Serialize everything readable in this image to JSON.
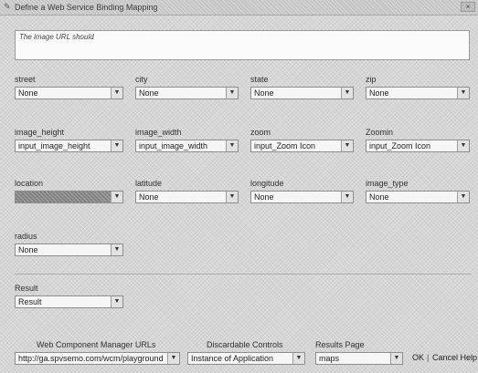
{
  "window": {
    "title": "Define a Web Service Binding Mapping",
    "close_glyph": "×",
    "title_icon": "pencil-icon"
  },
  "description": {
    "text": "The image URL should"
  },
  "fields": {
    "street": {
      "label": "street",
      "value": "None"
    },
    "city": {
      "label": "city",
      "value": "None"
    },
    "state": {
      "label": "state",
      "value": "None"
    },
    "zip": {
      "label": "zip",
      "value": "None"
    },
    "image_height": {
      "label": "image_height",
      "value": "input_image_height"
    },
    "image_width": {
      "label": "image_width",
      "value": "input_image_width"
    },
    "zoom": {
      "label": "zoom",
      "value": "input_Zoom Icon"
    },
    "zoom_icon": {
      "label": "Zoomin",
      "value": "input_Zoom Icon"
    },
    "location": {
      "label": "location",
      "value": ""
    },
    "latitude": {
      "label": "latitude",
      "value": "None"
    },
    "longitude": {
      "label": "longitude",
      "value": "None"
    },
    "image_type": {
      "label": "image_type",
      "value": "None"
    },
    "radius": {
      "label": "radius",
      "value": "None"
    },
    "result": {
      "label": "Result",
      "value": "Result"
    }
  },
  "footer": {
    "wcm_url": {
      "label": "Web Component Manager URLs",
      "value": "http://ga.spvsemo.com/wcm/playground"
    },
    "discardable_controls": {
      "label": "Discardable Controls",
      "value": "Instance of Application"
    },
    "results_page": {
      "label": "Results Page",
      "value": "maps"
    },
    "ok_label": "OK",
    "separator": "|",
    "cancel_label": "Cancel Help"
  },
  "icons": {
    "dropdown_arrow": "chevron-down-icon"
  },
  "colors": {
    "background": "#d6d6d6",
    "field_background": "#f6f6f6",
    "highlight": "#9a9a9a"
  }
}
